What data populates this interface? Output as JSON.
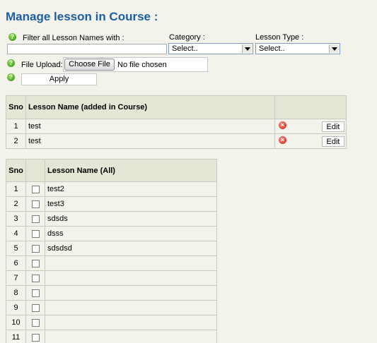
{
  "page": {
    "title": "Manage lesson in Course :"
  },
  "filters": {
    "lesson_filter_label": "Filter all Lesson Names with :",
    "lesson_filter_value": "",
    "category_label": "Category :",
    "category_selected": "Select..",
    "type_label": "Lesson Type :",
    "type_selected": "Select..",
    "upload_label": "File Upload:",
    "choose_file_label": "Choose File",
    "no_file_text": "No file chosen",
    "apply_label": "Apply"
  },
  "course_table": {
    "headers": [
      "Sno",
      "Lesson Name (added in Course)"
    ],
    "edit_label": "Edit",
    "rows": [
      {
        "sno": "1",
        "name": "test"
      },
      {
        "sno": "2",
        "name": "test"
      }
    ]
  },
  "all_table": {
    "headers": [
      "Sno",
      "Lesson Name (All)"
    ],
    "rows": [
      {
        "sno": "1",
        "name": "test2"
      },
      {
        "sno": "2",
        "name": "test3"
      },
      {
        "sno": "3",
        "name": "sdsds"
      },
      {
        "sno": "4",
        "name": "dsss"
      },
      {
        "sno": "5",
        "name": "sdsdsd"
      },
      {
        "sno": "6",
        "name": ""
      },
      {
        "sno": "7",
        "name": ""
      },
      {
        "sno": "8",
        "name": ""
      },
      {
        "sno": "9",
        "name": ""
      },
      {
        "sno": "10",
        "name": ""
      },
      {
        "sno": "11",
        "name": ""
      }
    ]
  },
  "icons": {
    "help": "help-icon",
    "delete": "delete-icon"
  },
  "colors": {
    "title": "#1c5ea3",
    "background": "#f3f3ec",
    "header_bg": "#e6e6d6"
  }
}
